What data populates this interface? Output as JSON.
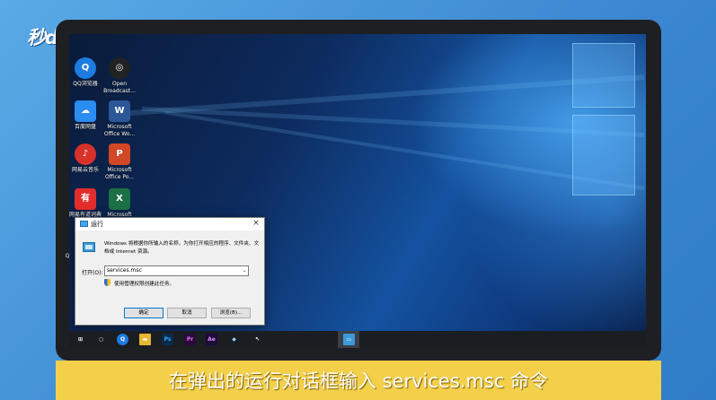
{
  "brand": {
    "logo_text": "秒dong视频",
    "tm": "®"
  },
  "desktop_icons": [
    {
      "label": "QQ浏览器",
      "icon": "qq-browser-icon",
      "color": "#1e7be0"
    },
    {
      "label": "Open Broadcast...",
      "icon": "obs-icon",
      "color": "#222222"
    },
    {
      "label": "百度网盘",
      "icon": "baidu-netdisk-icon",
      "color": "#2b8cf2"
    },
    {
      "label": "Microsoft Office Wo...",
      "icon": "word-icon",
      "color": "#2b5797"
    },
    {
      "label": "网易云音乐",
      "icon": "netease-music-icon",
      "color": "#d8312a"
    },
    {
      "label": "Microsoft Office Po...",
      "icon": "powerpoint-icon",
      "color": "#d24726"
    },
    {
      "label": "网易有道词典",
      "icon": "youdao-icon",
      "color": "#e32d2d"
    },
    {
      "label": "Microsoft",
      "icon": "excel-icon",
      "color": "#1d7044"
    },
    {
      "label": "Q",
      "icon": "partial-icon",
      "color": "#555555"
    }
  ],
  "run_dialog": {
    "title": "运行",
    "close": "×",
    "description": "Windows 将根据你所输入的名称，为你打开相应的程序、文件夹、文档或 Internet 资源。",
    "open_label": "打开(O):",
    "command_value": "services.msc",
    "admin_note": "使用管理权限创建此任务。",
    "buttons": {
      "ok": "确定",
      "cancel": "取消",
      "browse": "浏览(B)..."
    }
  },
  "taskbar": {
    "items": [
      {
        "icon": "windows-start-icon",
        "glyph": "⊞",
        "color": "transparent"
      },
      {
        "icon": "search-circle-icon",
        "glyph": "○",
        "color": "transparent"
      },
      {
        "icon": "qq-browser-icon",
        "glyph": "Q",
        "color": "#1e7be0"
      },
      {
        "icon": "file-explorer-icon",
        "glyph": "▬",
        "color": "#e8b631"
      },
      {
        "icon": "photoshop-icon",
        "glyph": "Ps",
        "color": "#0b2b4b"
      },
      {
        "icon": "premiere-icon",
        "glyph": "Pr",
        "color": "#2a0a3a"
      },
      {
        "icon": "after-effects-icon",
        "glyph": "Ae",
        "color": "#1f0a3a"
      },
      {
        "icon": "tool-icon",
        "glyph": "◆",
        "color": "transparent"
      },
      {
        "icon": "cursor-app-icon",
        "glyph": "↖",
        "color": "transparent"
      },
      {
        "icon": "run-dialog-task-icon",
        "glyph": "▭",
        "color": "#3b9ad9"
      }
    ]
  },
  "subtitle": "在弹出的运行对话框输入 services.msc 命令"
}
